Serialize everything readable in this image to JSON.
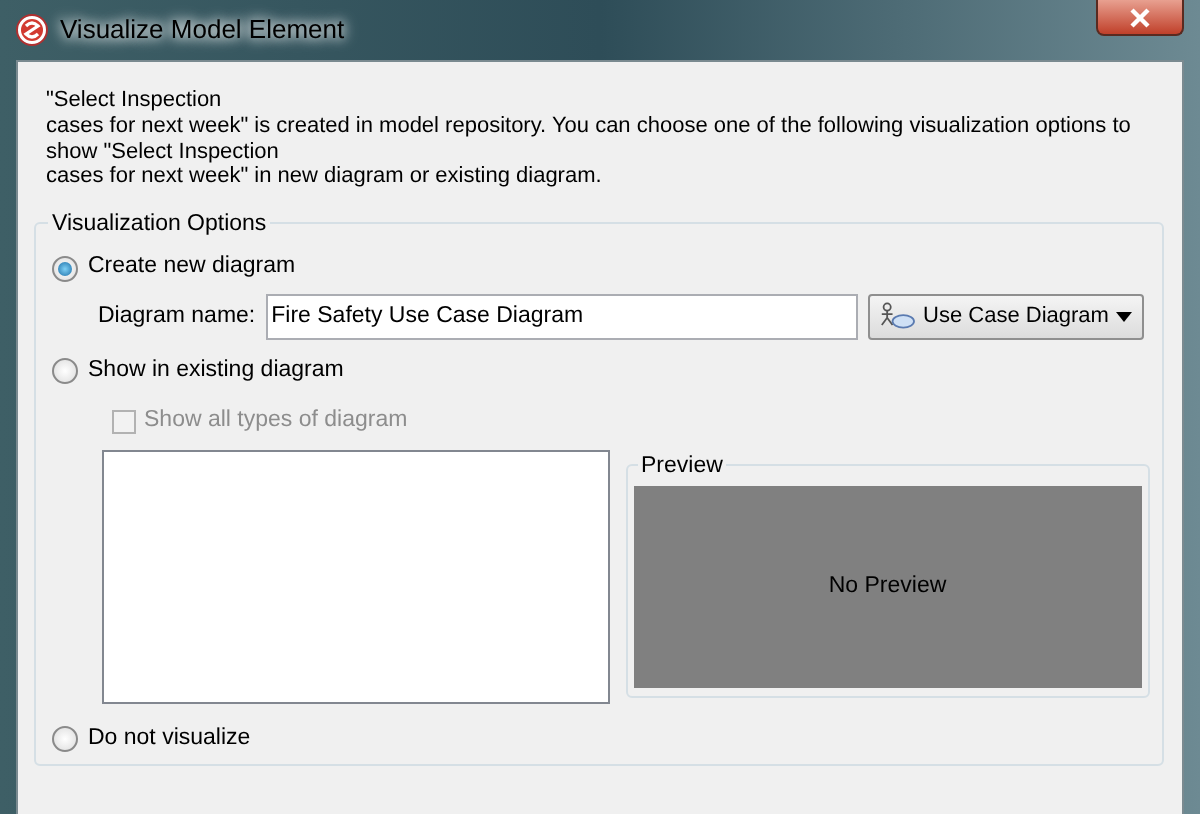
{
  "window": {
    "title": "Visualize Model Element"
  },
  "message_lines": [
    "\"Select Inspection",
    "cases for next week\" is created in model repository. You can choose one of the following visualization options to",
    "show \"Select Inspection",
    "cases for next week\" in new diagram or existing diagram."
  ],
  "options_group": {
    "title": "Visualization Options",
    "options": [
      {
        "label": "Create new diagram",
        "selected": true
      },
      {
        "label": "Show in existing diagram",
        "selected": false
      },
      {
        "label": "Do not visualize",
        "selected": false
      }
    ],
    "diagram_name": {
      "label": "Diagram name:",
      "value": "Fire Safety Use Case Diagram"
    },
    "diagram_type": {
      "label": "Use Case Diagram"
    },
    "show_all_types": {
      "label": "Show all types of diagram",
      "checked": false,
      "disabled": true
    },
    "preview": {
      "title": "Preview",
      "text": "No Preview"
    }
  }
}
